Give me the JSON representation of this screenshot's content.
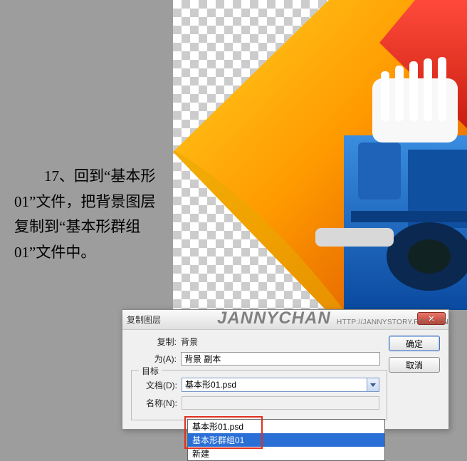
{
  "instruction": "　　17、回到“基本形01”文件，把背景图层复制到“基本形群组01”文件中。",
  "watermark": {
    "brand": "JANNYCHAN",
    "url": "HTTP://JANNYSTORY.POCO.CN"
  },
  "dialog": {
    "title": "复制图层",
    "copy_label": "复制:",
    "copy_value": "背景",
    "as_label": "为(A):",
    "as_value": "背景 副本",
    "target_legend": "目标",
    "doc_label": "文档(D):",
    "doc_value": "基本形01.psd",
    "name_label": "名称(N):",
    "options": [
      "基本形01.psd",
      "基本形群组01",
      "新建"
    ],
    "ok": "确定",
    "cancel": "取消",
    "close_glyph": "✕"
  }
}
